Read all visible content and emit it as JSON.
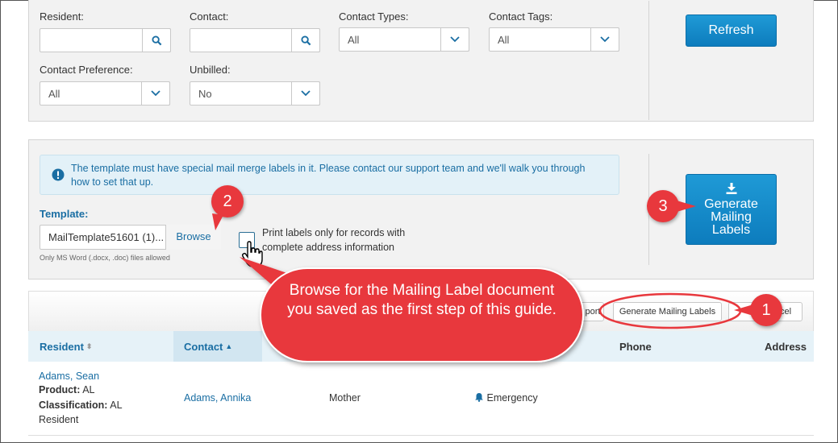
{
  "filters": {
    "resident_label": "Resident:",
    "contact_label": "Contact:",
    "contact_types_label": "Contact Types:",
    "contact_types_value": "All",
    "contact_tags_label": "Contact Tags:",
    "contact_tags_value": "All",
    "contact_pref_label": "Contact Preference:",
    "contact_pref_value": "All",
    "unbilled_label": "Unbilled:",
    "unbilled_value": "No",
    "refresh_label": "Refresh"
  },
  "template_panel": {
    "info_text": "The template must have special mail merge labels in it. Please contact our support team and we'll walk you through how to set that up.",
    "template_label": "Template:",
    "file_value": "MailTemplate51601 (1)...",
    "browse_label": "Browse",
    "help_text": "Only MS Word (.docx, .doc) files allowed",
    "checkbox_text": "Print labels only for records with complete address information",
    "generate_line1": "Generate",
    "generate_line2": "Mailing",
    "generate_line3": "Labels"
  },
  "toolbar": {
    "export_fragment": "port",
    "generate_btn": "Generate Mailing Labels",
    "excel_fragment": "cel"
  },
  "table": {
    "headers": {
      "resident": "Resident",
      "contact": "Contact",
      "phone": "Phone",
      "address": "Address"
    },
    "row": {
      "resident_name": "Adams, Sean",
      "product_label": "Product:",
      "product_value": "AL",
      "class_label": "Classification:",
      "class_value": "AL",
      "class_value2": "Resident",
      "contact_name": "Adams, Annika",
      "relationship": "Mother",
      "contact_type": "Emergency"
    }
  },
  "callouts": {
    "bubble_text": "Browse for the Mailing Label document you saved as the first step of this guide.",
    "badge1": "1",
    "badge2": "2",
    "badge3": "3"
  },
  "colors": {
    "primary": "#1287c8",
    "callout": "#e8383d",
    "info_bg": "#e3f1f8",
    "link": "#1a6ea3"
  }
}
